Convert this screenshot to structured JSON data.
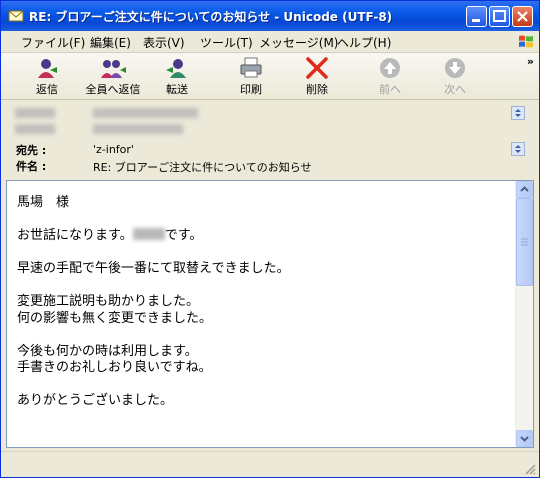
{
  "window": {
    "title": "RE: ブロアーご注文に件についてのお知らせ - Unicode (UTF-8)"
  },
  "menu": [
    "ファイル(F)",
    "編集(E)",
    "表示(V)",
    "ツール(T)",
    "メッセージ(M)",
    "ヘルプ(H)"
  ],
  "toolbar": {
    "reply": "返信",
    "reply_all": "全員へ返信",
    "forward": "転送",
    "print": "印刷",
    "delete": "削除",
    "prev": "前へ",
    "next": "次へ",
    "more": "»"
  },
  "headers": {
    "to_label": "宛先 :",
    "to_value": "'z-infor'",
    "subject_label": "件名 :",
    "subject_value": "RE: ブロアーご注文に件についてのお知らせ"
  },
  "body": {
    "lines": [
      "馬場　様",
      "",
      "お世話になります。",
      "です。",
      "",
      "早速の手配で午後一番にて取替えできました。",
      "",
      "変更施工説明も助かりました。",
      "何の影響も無く変更できました。",
      "",
      "今後も何かの時は利用します。",
      "手書きのお礼しおり良いですね。",
      "",
      "ありがとうございました。"
    ]
  },
  "colors": {
    "titlebar": "#0a5bea",
    "close_button": "#c43a16",
    "delete_icon": "#e0281c",
    "disabled": "#a0a0a0"
  }
}
